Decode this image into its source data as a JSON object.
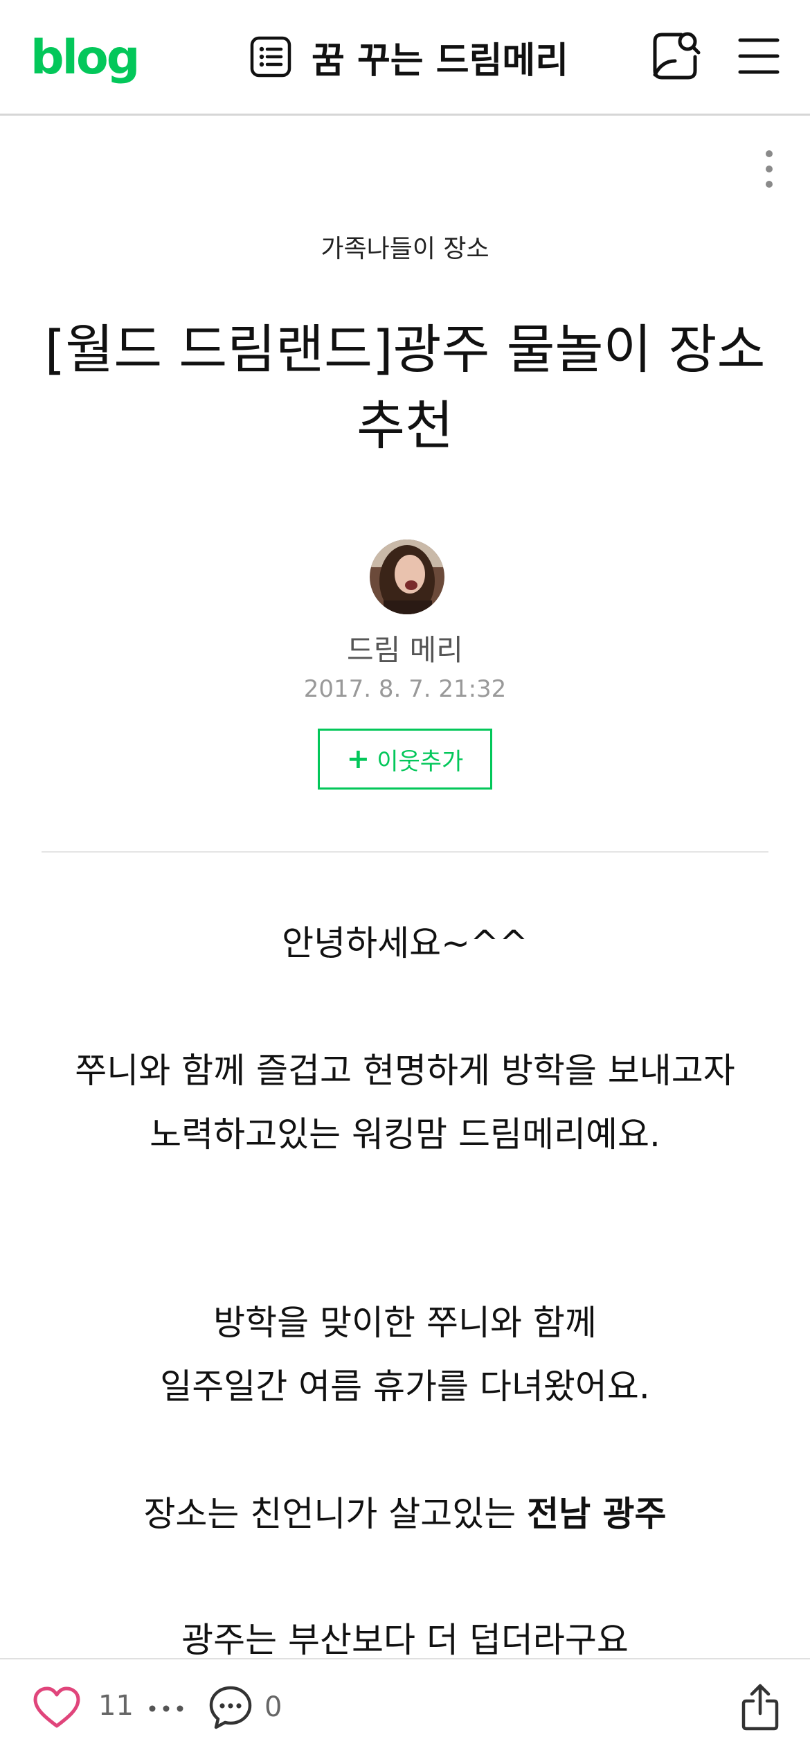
{
  "header": {
    "logo": "blog",
    "blog_name": "꿈 꾸는 드림메리"
  },
  "post": {
    "category": "가족나들이 장소",
    "title": "[월드 드림랜드]광주 물놀이 장소 추천",
    "author": "드림 메리",
    "date": "2017. 8. 7. 21:32",
    "follow_label": "이웃추가"
  },
  "body": {
    "greeting": "안녕하세요~^^",
    "para1_line1": "쭈니와 함께 즐겁고 현명하게 방학을 보내고자",
    "para1_line2": "노력하고있는 워킹맘 드림메리예요.",
    "para2_line1": "방학을 맞이한 쭈니와 함께",
    "para2_line2": "일주일간 여름 휴가를 다녀왔어요.",
    "para3_text": "장소는 친언니가 살고있는 ",
    "para3_bold": "전남 광주",
    "para4": "광주는 부산보다 더 덥더라구요"
  },
  "bottom_bar": {
    "like_count": "11",
    "comment_count": "0"
  },
  "colors": {
    "brand_green": "#03c75a",
    "like_pink": "#e0457b"
  },
  "icons": {
    "list": "list-icon",
    "search_profile": "search-profile-icon",
    "menu": "menu-icon",
    "more": "more-icon",
    "like": "heart-icon",
    "dots": "dots-icon",
    "comment": "comment-icon",
    "share": "share-icon"
  }
}
